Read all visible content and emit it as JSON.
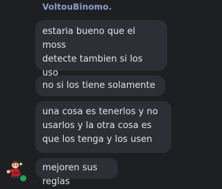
{
  "sender": {
    "name": "VoltouBinomo.",
    "name_color": "#8e9ccf",
    "status_color": "#23a55a",
    "avatar_icon": "cartoon-character-avatar"
  },
  "messages": [
    {
      "text": "estaria bueno que el moss\ndetecte tambien si los uso\nen la partida"
    },
    {
      "text": "no si los tiene solamente"
    },
    {
      "text": "una cosa es tenerlos y no\nusarlos y la otra cosa es\nque los tenga y los usen"
    },
    {
      "text": "mejoren sus reglas"
    }
  ],
  "theme": {
    "background": "#1e1f22",
    "bubble": "#2c2f36",
    "text": "#e3e5e8"
  }
}
